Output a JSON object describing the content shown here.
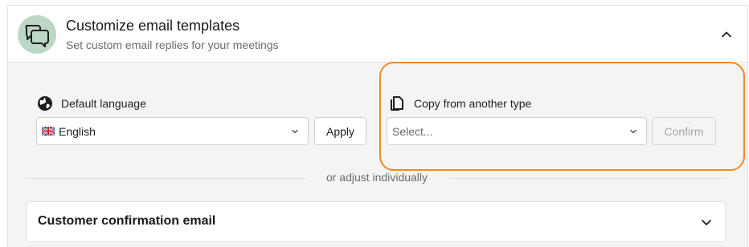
{
  "header": {
    "title": "Customize email templates",
    "subtitle": "Set custom email replies for your meetings",
    "icon": "chat-bubbles-icon",
    "icon_bg": "#bcd7c5"
  },
  "default_language": {
    "label": "Default language",
    "icon": "globe-icon",
    "selected": "English",
    "flag": "uk-flag-icon",
    "apply_label": "Apply"
  },
  "copy_from": {
    "label": "Copy from another type",
    "icon": "copy-icon",
    "placeholder": "Select...",
    "confirm_label": "Confirm",
    "highlight_color": "#f08a24"
  },
  "divider_text": "or adjust individually",
  "accordion": {
    "title": "Customer confirmation email"
  }
}
